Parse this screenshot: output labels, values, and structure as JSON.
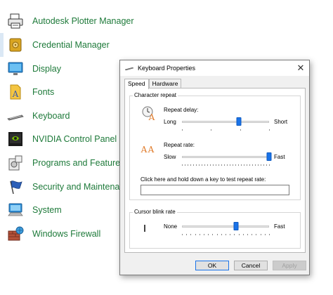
{
  "control_panel": {
    "items": [
      {
        "label": "Autodesk Plotter Manager",
        "icon": "plotter-icon"
      },
      {
        "label": "Credential Manager",
        "icon": "credential-safe-icon",
        "selected": true
      },
      {
        "label": "Display",
        "icon": "monitor-icon"
      },
      {
        "label": "Fonts",
        "icon": "fonts-icon"
      },
      {
        "label": "Keyboard",
        "icon": "keyboard-icon"
      },
      {
        "label": "NVIDIA Control Panel",
        "icon": "nvidia-icon"
      },
      {
        "label": "Programs and Features",
        "icon": "programs-icon"
      },
      {
        "label": "Security and Maintenance",
        "icon": "flag-icon"
      },
      {
        "label": "System",
        "icon": "computer-icon"
      },
      {
        "label": "Windows Firewall",
        "icon": "firewall-icon"
      }
    ]
  },
  "dialog": {
    "title": "Keyboard Properties",
    "close": "✕",
    "tabs": [
      {
        "label": "Speed",
        "active": true
      },
      {
        "label": "Hardware",
        "active": false
      }
    ],
    "character_repeat": {
      "title": "Character repeat",
      "repeat_delay": {
        "label": "Repeat delay:",
        "min_label": "Long",
        "max_label": "Short",
        "value": 0.65,
        "ticks": 4
      },
      "repeat_rate": {
        "label": "Repeat rate:",
        "min_label": "Slow",
        "max_label": "Fast",
        "value": 1.0,
        "ticks": 32
      },
      "test_label": "Click here and hold down a key to test repeat rate:",
      "test_value": ""
    },
    "cursor_blink": {
      "title": "Cursor blink rate",
      "min_label": "None",
      "max_label": "Fast",
      "value": 0.62,
      "ticks": 21
    },
    "buttons": {
      "ok": "OK",
      "cancel": "Cancel",
      "apply": "Apply"
    }
  },
  "colors": {
    "link_text": "#1e7a3a",
    "accent": "#1a73e8"
  }
}
